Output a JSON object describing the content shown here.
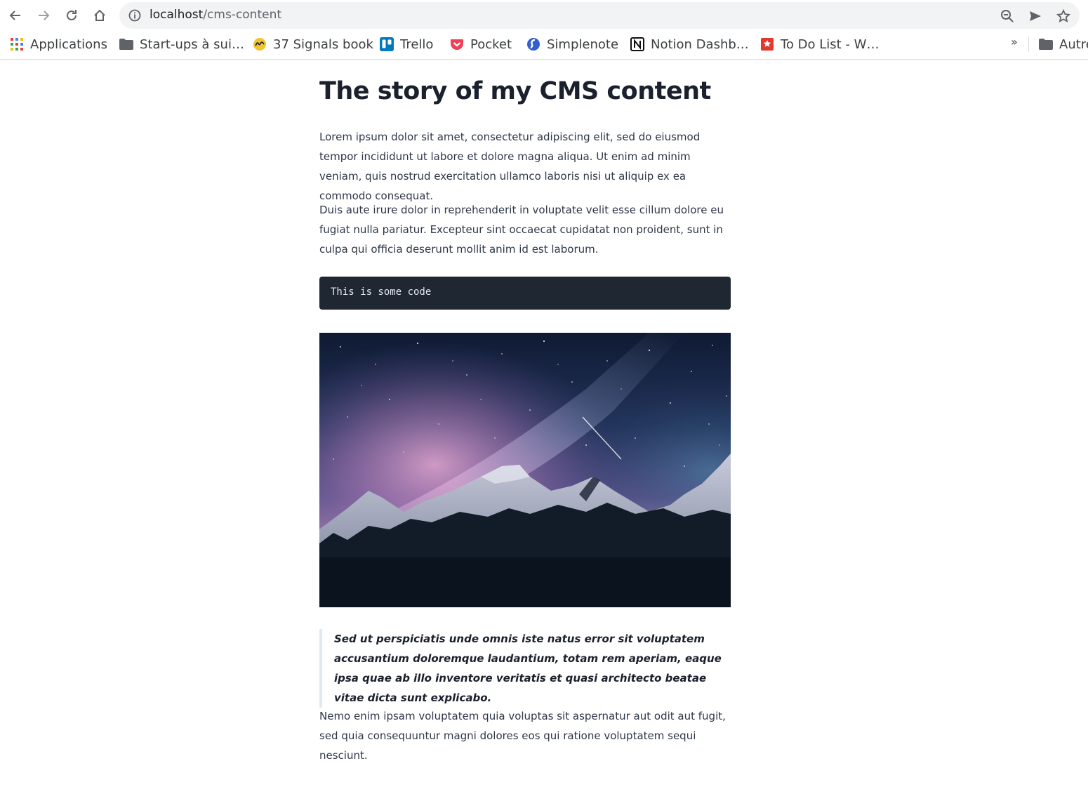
{
  "browser": {
    "url_host": "localhost",
    "url_path": "/cms-content"
  },
  "bookmarks": [
    {
      "label": "Applications",
      "icon": "apps-grid-icon"
    },
    {
      "label": "Start-ups à sui…",
      "icon": "folder-icon"
    },
    {
      "label": "37 Signals book",
      "icon": "basecamp-icon"
    },
    {
      "label": "Trello",
      "icon": "trello-icon"
    },
    {
      "label": "Pocket",
      "icon": "pocket-icon"
    },
    {
      "label": "Simplenote",
      "icon": "simplenote-icon"
    },
    {
      "label": "Notion Dashb…",
      "icon": "notion-icon"
    },
    {
      "label": "To Do List - W…",
      "icon": "todo-icon"
    },
    {
      "label": "Autre",
      "icon": "folder-icon"
    }
  ],
  "bookmarks_overflow": "»",
  "article": {
    "title": "The story of my CMS content",
    "paragraph1": "Lorem ipsum dolor sit amet, consectetur adipiscing elit, sed do eiusmod tempor incididunt ut labore et dolore magna aliqua. Ut enim ad minim veniam, quis nostrud exercitation ullamco laboris nisi ut aliquip ex ea commodo consequat.",
    "paragraph2": "Duis aute irure dolor in reprehenderit in voluptate velit esse cillum dolore eu fugiat nulla pariatur. Excepteur sint occaecat cupidatat non proident, sunt in culpa qui officia deserunt mollit anim id est laborum.",
    "code": "This is some code",
    "quote": "Sed ut perspiciatis unde omnis iste natus error sit voluptatem accusantium doloremque laudantium, totam rem aperiam, eaque ipsa quae ab illo inventore veritatis et quasi architecto beatae vitae dicta sunt explicabo.",
    "paragraph3": "Nemo enim ipsam voluptatem quia voluptas sit aspernatur aut odit aut fugit, sed quia consequuntur magni dolores eos qui ratione voluptatem sequi nesciunt."
  }
}
